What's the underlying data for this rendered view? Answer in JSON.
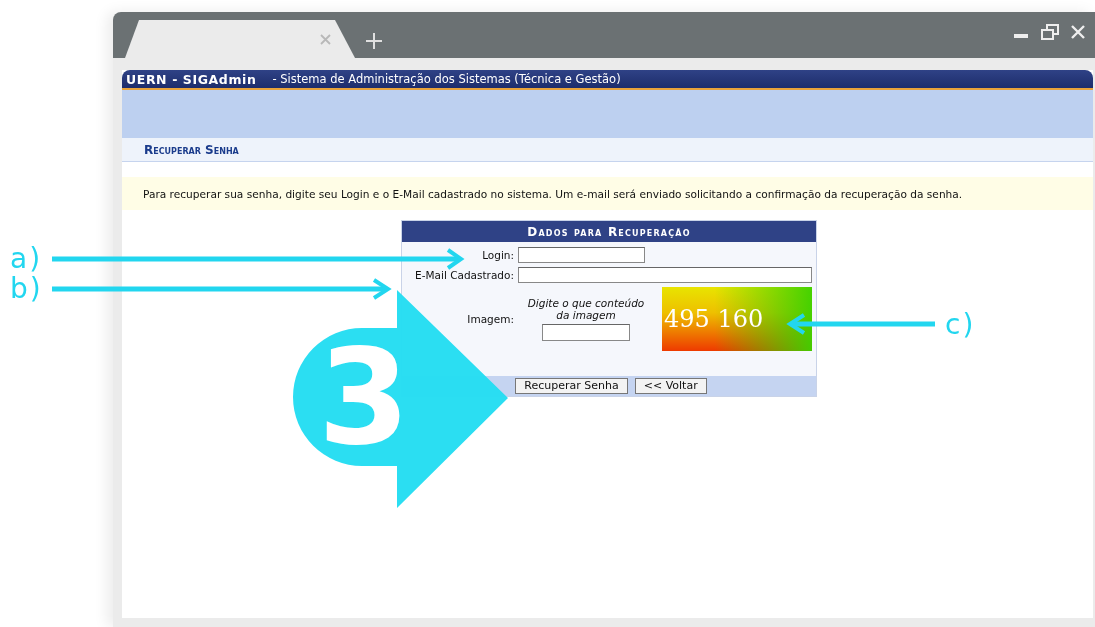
{
  "header": {
    "system": "UERN - SIGAdmin",
    "subtitle": "- Sistema de Administração dos Sistemas (Técnica e Gestão)"
  },
  "page_title": "Recuperar Senha",
  "notice": "Para recuperar sua senha, digite seu Login e o E-Mail cadastrado no sistema. Um e-mail será enviado solicitando a confirmação da recuperação da senha.",
  "form": {
    "title": "Dados para Recuperação",
    "fields": [
      {
        "label": "Login:",
        "kind": "short"
      },
      {
        "label": "E-Mail Cadastrado:",
        "kind": "long"
      },
      {
        "label": "Imagem:",
        "kind": "captcha",
        "hint": "Digite o que conteúdo da imagem",
        "captcha_text": "495 160"
      }
    ],
    "buttons": [
      "Recuperar Senha",
      "<< Voltar"
    ]
  },
  "annotations": {
    "labels": [
      "a)",
      "b)",
      "c)"
    ],
    "step": "3"
  }
}
